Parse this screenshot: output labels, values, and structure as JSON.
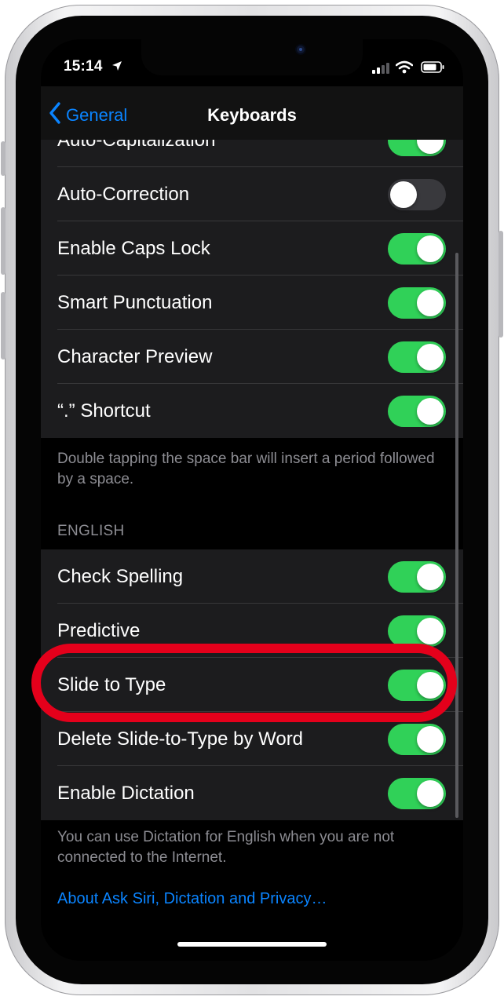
{
  "status_bar": {
    "time": "15:14",
    "icons": [
      "location-arrow-icon",
      "cellular-signal-icon",
      "wifi-icon",
      "battery-icon"
    ]
  },
  "nav": {
    "back_label": "General",
    "title": "Keyboards"
  },
  "group1": {
    "rows": [
      {
        "label": "Auto-Capitalization",
        "on": true
      },
      {
        "label": "Auto-Correction",
        "on": false
      },
      {
        "label": "Enable Caps Lock",
        "on": true
      },
      {
        "label": "Smart Punctuation",
        "on": true
      },
      {
        "label": "Character Preview",
        "on": true
      },
      {
        "label": "“.” Shortcut",
        "on": true
      }
    ],
    "footer": "Double tapping the space bar will insert a period followed by a space."
  },
  "english": {
    "header": "ENGLISH",
    "rows": [
      {
        "label": "Check Spelling",
        "on": true
      },
      {
        "label": "Predictive",
        "on": true
      },
      {
        "label": "Slide to Type",
        "on": true
      },
      {
        "label": "Delete Slide-to-Type by Word",
        "on": true
      },
      {
        "label": "Enable Dictation",
        "on": true
      }
    ],
    "footer": "You can use Dictation for English when you are not connected to the Internet.",
    "link": "About Ask Siri, Dictation and Privacy…"
  },
  "colors": {
    "accent": "#0a84ff",
    "toggle_on": "#30d158",
    "highlight": "#e4001b",
    "cell_bg": "#1c1c1e"
  }
}
